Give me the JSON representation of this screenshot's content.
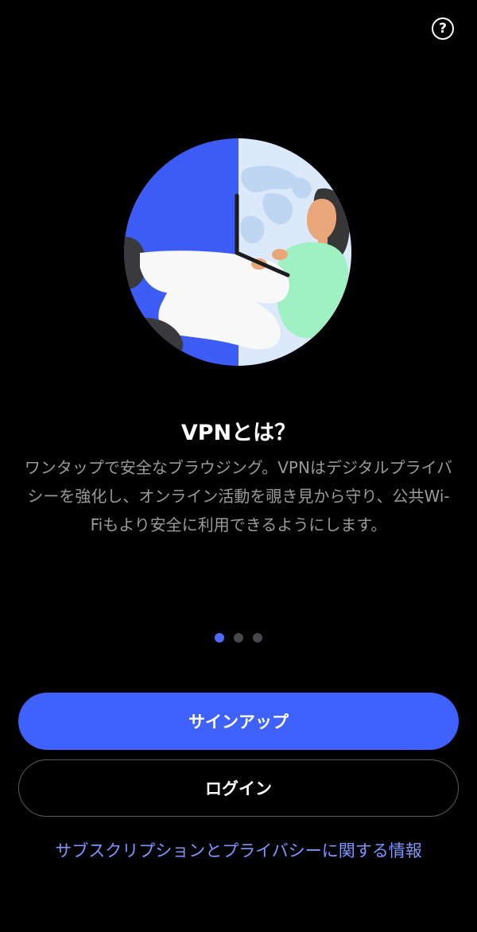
{
  "header": {
    "help_glyph": "?"
  },
  "onboarding": {
    "title": "VPNとは？",
    "description": "ワンタップで安全なブラウジング。VPNはデジタルプライバシーを強化し、オンライン活動を覗き見から守り、公共Wi-Fiもより安全に利用できるようにします。",
    "page_indicator": {
      "total": 3,
      "current": 1
    }
  },
  "actions": {
    "signup_label": "サインアップ",
    "login_label": "ログイン",
    "subscription_privacy_link": "サブスクリプションとプライバシーに関する情報"
  },
  "colors": {
    "background": "#000000",
    "accent": "#3f62ff",
    "dot_active": "#4e6bff",
    "dot_inactive": "#48484a",
    "link": "#7f95ff"
  }
}
